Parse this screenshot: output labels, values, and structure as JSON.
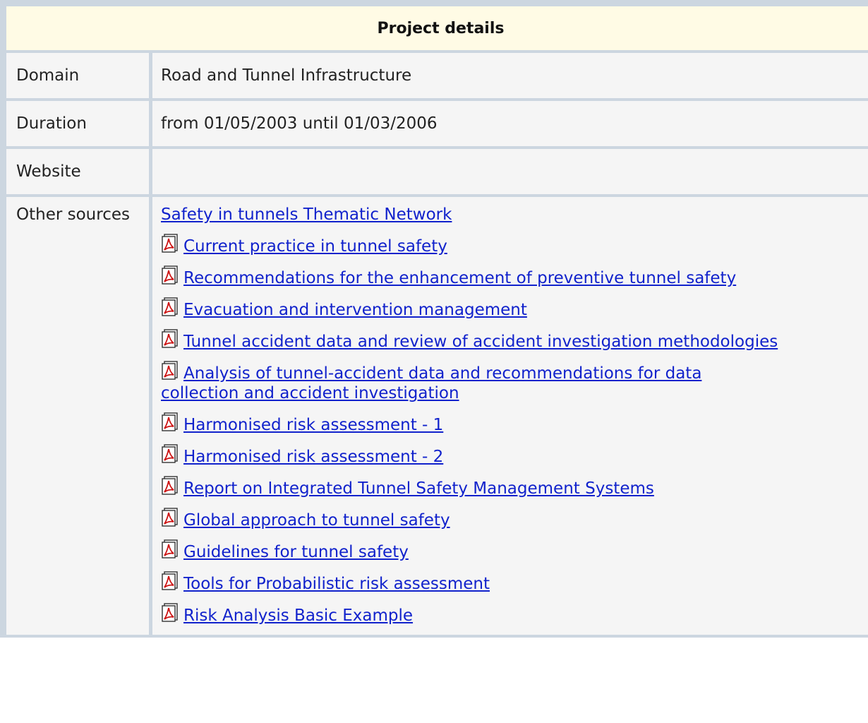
{
  "header": {
    "title": "Project details"
  },
  "rows": {
    "domain": {
      "label": "Domain",
      "value": "Road and Tunnel Infrastructure"
    },
    "duration": {
      "label": "Duration",
      "value": "from 01/05/2003 until 01/03/2006"
    },
    "website": {
      "label": "Website",
      "value": ""
    },
    "other_sources": {
      "label": "Other sources"
    }
  },
  "sources": [
    {
      "text": "Safety in tunnels Thematic Network",
      "icon": ""
    },
    {
      "text": "Current practice in tunnel safety",
      "icon": "pdf-icon"
    },
    {
      "text": "Recommendations for the enhancement of preventive tunnel safety",
      "icon": "pdf-icon"
    },
    {
      "text": "Evacuation and intervention management",
      "icon": "pdf-icon"
    },
    {
      "text": "Tunnel accident data and review of accident investigation methodologies",
      "icon": "pdf-icon"
    },
    {
      "text": "Analysis of tunnel-accident data and recommendations for data collection and accident investigation",
      "icon": "pdf-icon"
    },
    {
      "text": "Harmonised risk assessment - 1",
      "icon": "pdf-icon"
    },
    {
      "text": "Harmonised risk assessment - 2",
      "icon": "pdf-icon"
    },
    {
      "text": "Report on Integrated Tunnel Safety Management Systems",
      "icon": "pdf-icon"
    },
    {
      "text": "Global approach to tunnel safety",
      "icon": "pdf-icon"
    },
    {
      "text": "Guidelines for tunnel safety",
      "icon": "pdf-icon"
    },
    {
      "text": "Tools for Probabilistic risk assessment",
      "icon": "pdf-icon"
    },
    {
      "text": "Risk Analysis Basic Example",
      "icon": "pdf-icon"
    }
  ],
  "colors": {
    "link": "#1122cc",
    "header_bg": "#fffbe5",
    "cell_bg": "#f5f5f5",
    "border": "#ccd6e0"
  }
}
